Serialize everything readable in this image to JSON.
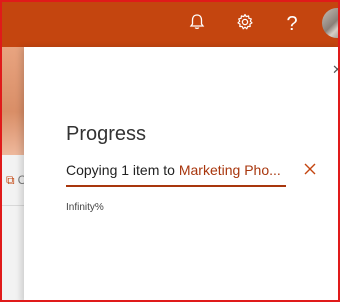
{
  "topbar": {
    "icons": [
      "bell-icon",
      "gear-icon",
      "help-icon"
    ],
    "help_glyph": "?",
    "accent_color": "#c4450f"
  },
  "background": {
    "peek_text": "Co"
  },
  "panel": {
    "close_glyph": "✕",
    "title": "Progress",
    "status_prefix": "Copying 1 item to ",
    "status_target": "Marketing Pho...",
    "cancel_glyph": "✕",
    "progress_fraction": 1.0,
    "percent_text": "Infinity%"
  }
}
